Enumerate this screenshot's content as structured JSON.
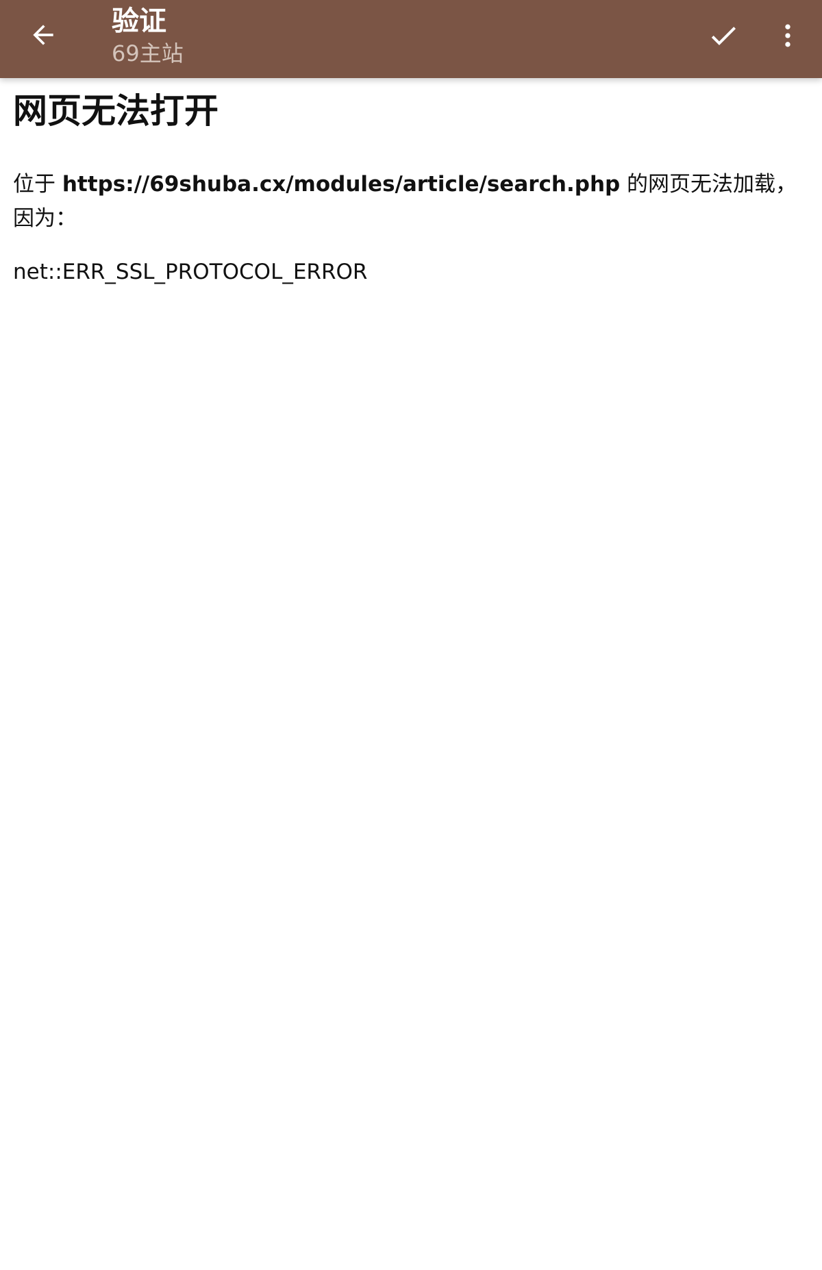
{
  "toolbar": {
    "title": "验证",
    "subtitle": "69主站",
    "back_icon": "arrow-back-icon",
    "confirm_icon": "check-icon",
    "more_icon": "more-vert-icon",
    "background_color": "#7b5545"
  },
  "error_page": {
    "heading": "网页无法打开",
    "message_prefix": "位于 ",
    "url": "https://69shuba.cx/modules/article/search.php",
    "message_suffix": " 的网页无法加载，因为：",
    "error_code": "net::ERR_SSL_PROTOCOL_ERROR"
  }
}
